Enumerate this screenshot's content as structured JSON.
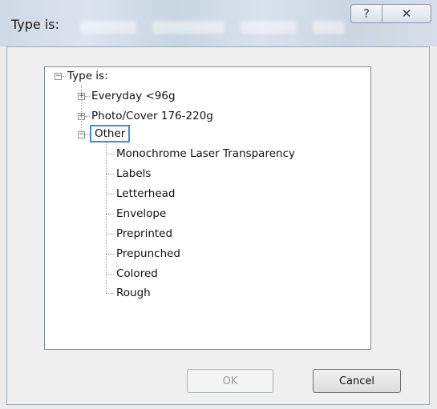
{
  "window": {
    "title": "Type is:"
  },
  "titlebar": {
    "help_glyph": "?",
    "close_glyph": "✕"
  },
  "tree": {
    "root_label": "Type is:",
    "nodes": [
      {
        "label": "Everyday <96g",
        "expander": "+"
      },
      {
        "label": "Photo/Cover 176-220g",
        "expander": "+"
      },
      {
        "label": "Other",
        "expander": "−",
        "selected": true,
        "children": [
          "Monochrome Laser Transparency",
          "Labels",
          "Letterhead",
          "Envelope",
          "Preprinted",
          "Prepunched",
          "Colored",
          "Rough"
        ]
      }
    ],
    "root_expander": "−"
  },
  "buttons": {
    "ok": "OK",
    "cancel": "Cancel"
  },
  "colors": {
    "selection_border": "#3c8fd0"
  }
}
